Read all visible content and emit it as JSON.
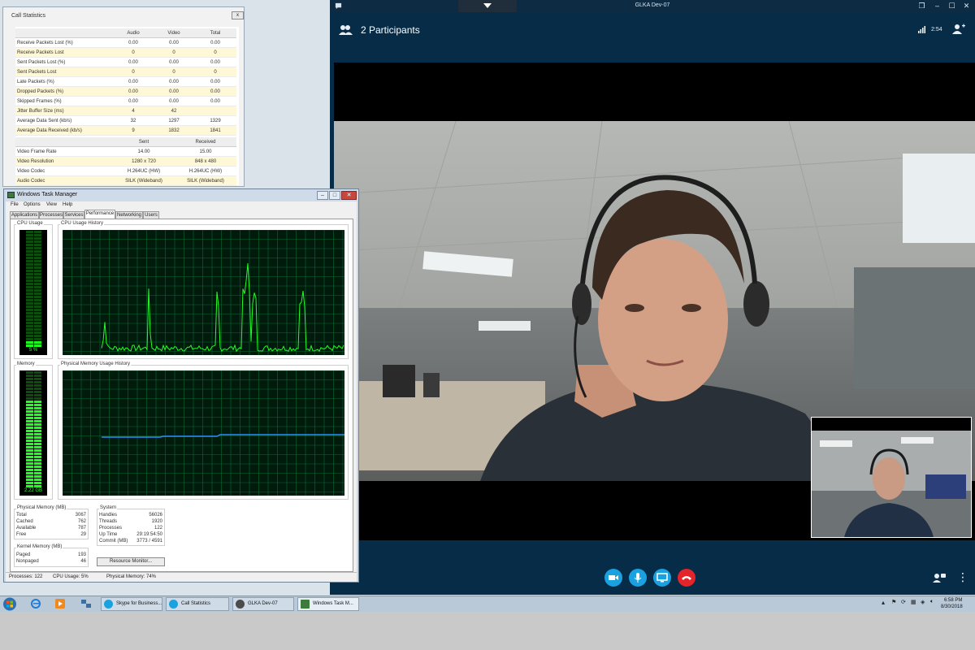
{
  "skype": {
    "window_title": "GLKA Dev-07",
    "participants_label": "2 Participants",
    "call_duration": "2:54",
    "controls": [
      "video-button",
      "mute-button",
      "share-screen-button",
      "hang-up-button"
    ],
    "colors": {
      "accent": "#1aa1e0",
      "hangup": "#e3242b",
      "background": "#062c47"
    }
  },
  "call_stats": {
    "title": "Call Statistics",
    "close_label": "x",
    "audio_video_headers": [
      "",
      "Audio",
      "Video",
      "Total"
    ],
    "audio_video_rows": [
      {
        "label": "Receive Packets Lost (%)",
        "values": [
          "0.00",
          "0.00",
          "0.00"
        ]
      },
      {
        "label": "Receive Packets Lost",
        "values": [
          "0",
          "0",
          "0"
        ]
      },
      {
        "label": "Sent Packets Lost (%)",
        "values": [
          "0.00",
          "0.00",
          "0.00"
        ]
      },
      {
        "label": "Sent Packets Lost",
        "values": [
          "0",
          "0",
          "0"
        ]
      },
      {
        "label": "Late Packets (%)",
        "values": [
          "0.00",
          "0.00",
          "0.00"
        ]
      },
      {
        "label": "Dropped Packets (%)",
        "values": [
          "0.00",
          "0.00",
          "0.00"
        ]
      },
      {
        "label": "Skipped Frames (%)",
        "values": [
          "0.00",
          "0.00",
          "0.00"
        ]
      },
      {
        "label": "Jitter Buffer Size (ms)",
        "values": [
          "4",
          "42",
          ""
        ]
      },
      {
        "label": "Average Data Sent (kb/s)",
        "values": [
          "32",
          "1297",
          "1329"
        ]
      },
      {
        "label": "Average Data Received (kb/s)",
        "values": [
          "9",
          "1832",
          "1841"
        ]
      }
    ],
    "video_headers": [
      "",
      "Sent",
      "Received"
    ],
    "video_rows": [
      {
        "label": "Video Frame Rate",
        "values": [
          "14.00",
          "15.00"
        ]
      },
      {
        "label": "Video Resolution",
        "values": [
          "1280 x 720",
          "848 x 480"
        ]
      },
      {
        "label": "Video Codec",
        "values": [
          "H.264UC (HW)",
          "H.264UC (HW)"
        ]
      },
      {
        "label": "Audio Codec",
        "values": [
          "SILK (Wideband)",
          "SILK (Wideband)"
        ]
      }
    ]
  },
  "task_manager": {
    "title": "Windows Task Manager",
    "menus": [
      "File",
      "Options",
      "View",
      "Help"
    ],
    "tabs": [
      "Applications",
      "Processes",
      "Services",
      "Performance",
      "Networking",
      "Users"
    ],
    "active_tab": "Performance",
    "cpu_usage_title": "CPU Usage",
    "cpu_usage_value": "5 %",
    "cpu_usage_fraction": 0.05,
    "cpu_history_title": "CPU Usage History",
    "memory_title": "Memory",
    "memory_value": "2.22 GB",
    "memory_fraction": 0.74,
    "memory_history_title": "Physical Memory Usage History",
    "physical_memory": {
      "title": "Physical Memory (MB)",
      "rows": [
        {
          "k": "Total",
          "v": "3067"
        },
        {
          "k": "Cached",
          "v": "762"
        },
        {
          "k": "Available",
          "v": "787"
        },
        {
          "k": "Free",
          "v": "29"
        }
      ]
    },
    "kernel_memory": {
      "title": "Kernel Memory (MB)",
      "rows": [
        {
          "k": "Paged",
          "v": "193"
        },
        {
          "k": "Nonpaged",
          "v": "46"
        }
      ]
    },
    "system": {
      "title": "System",
      "rows": [
        {
          "k": "Handles",
          "v": "56026"
        },
        {
          "k": "Threads",
          "v": "1920"
        },
        {
          "k": "Processes",
          "v": "122"
        },
        {
          "k": "Up Time",
          "v": "29:19:54:50"
        },
        {
          "k": "Commit (MB)",
          "v": "3773 / 4591"
        }
      ]
    },
    "resource_monitor_label": "Resource Monitor...",
    "status": {
      "processes": "Processes: 122",
      "cpu": "CPU Usage: 5%",
      "memory": "Physical Memory: 74%"
    }
  },
  "taskbar": {
    "items": [
      {
        "label": "Skype for Business...",
        "icon": "skype-icon"
      },
      {
        "label": "Call Statistics",
        "icon": "skype-icon"
      },
      {
        "label": "GLKA Dev-07",
        "icon": "chat-bubble-icon"
      },
      {
        "label": "Windows Task M...",
        "icon": "task-manager-icon"
      }
    ],
    "clock_time": "6:58 PM",
    "clock_date": "8/30/2018"
  }
}
